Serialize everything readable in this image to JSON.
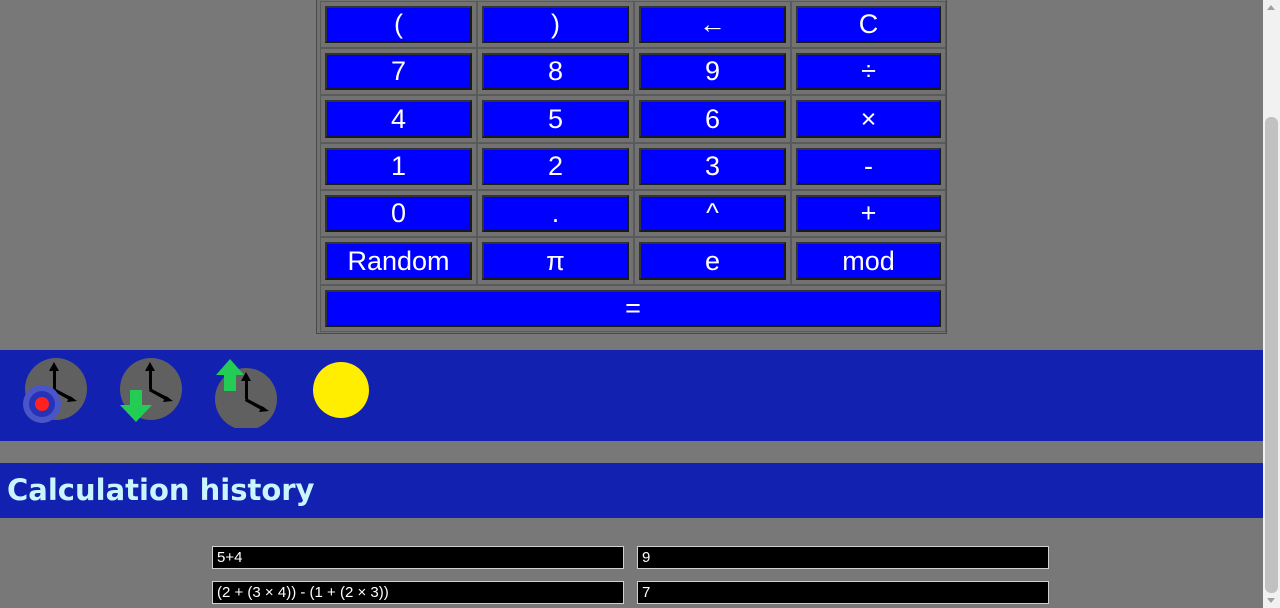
{
  "keypad": {
    "rows": [
      [
        "(",
        ")",
        "←",
        "C"
      ],
      [
        "7",
        "8",
        "9",
        "÷"
      ],
      [
        "4",
        "5",
        "6",
        "×"
      ],
      [
        "1",
        "2",
        "3",
        "-"
      ],
      [
        "0",
        ".",
        "^",
        "+"
      ],
      [
        "Random",
        "π",
        "e",
        "mod"
      ]
    ],
    "equals": "="
  },
  "toolbar": {
    "icons": [
      "clock-record-icon",
      "clock-download-icon",
      "clock-upload-icon",
      "sun-theme-icon"
    ]
  },
  "history": {
    "title": "Calculation history",
    "entries": [
      {
        "expression": "5+4",
        "result": "9"
      },
      {
        "expression": "(2 + (3 × 4)) - (1 + (2 × 3))",
        "result": "7"
      }
    ]
  },
  "colors": {
    "key_bg": "#0000ff",
    "toolbar_bg": "#1321b0",
    "page_bg": "#787878",
    "history_title": "#c9f5ff",
    "sun": "#ffee00",
    "arrow_green": "#22cc55"
  }
}
